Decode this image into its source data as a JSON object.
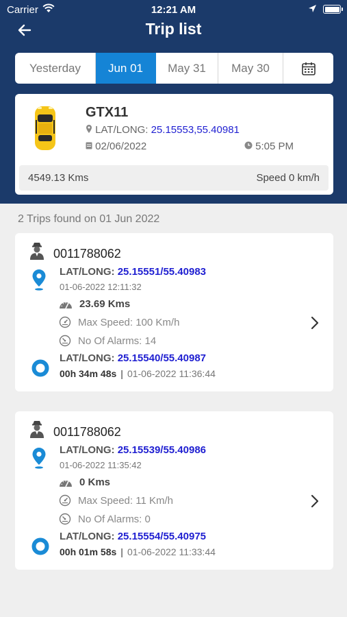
{
  "status_bar": {
    "carrier": "Carrier",
    "time": "12:21 AM"
  },
  "header": {
    "title": "Trip list"
  },
  "date_tabs": [
    {
      "label": "Yesterday",
      "active": false
    },
    {
      "label": "Jun 01",
      "active": true
    },
    {
      "label": "May 31",
      "active": false
    },
    {
      "label": "May 30",
      "active": false
    },
    {
      "icon": "calendar-icon"
    }
  ],
  "vehicle": {
    "name": "GTX11",
    "latlong_label": "LAT/LONG:",
    "latlong_value": "25.15553,55.40981",
    "date": "02/06/2022",
    "time": "5:05 PM",
    "kms": "4549.13 Kms",
    "speed": "Speed 0 km/h"
  },
  "summary": "2 Trips found on 01 Jun 2022",
  "trips": [
    {
      "driver_id": "0011788062",
      "start_latlong_label": "LAT/LONG:",
      "start_latlong_value": "25.15551/55.40983",
      "start_datetime": "01-06-2022 12:11:32",
      "distance": "23.69 Kms",
      "max_speed": "Max Speed: 100 Km/h",
      "alarms": "No Of Alarms: 14",
      "end_latlong_label": "LAT/LONG:",
      "end_latlong_value": "25.15540/55.40987",
      "duration": "00h 34m 48s",
      "separator": "|",
      "end_datetime": "01-06-2022 11:36:44"
    },
    {
      "driver_id": "0011788062",
      "start_latlong_label": "LAT/LONG:",
      "start_latlong_value": "25.15539/55.40986",
      "start_datetime": "01-06-2022 11:35:42",
      "distance": "0 Kms",
      "max_speed": "Max Speed: 11 Km/h",
      "alarms": "No Of Alarms: 0",
      "end_latlong_label": "LAT/LONG:",
      "end_latlong_value": "25.15554/55.40975",
      "duration": "00h 01m 58s",
      "separator": "|",
      "end_datetime": "01-06-2022 11:33:44"
    }
  ],
  "colors": {
    "header_bg": "#1b3a6a",
    "active_tab": "#1584d6",
    "coordinate_text": "#1f1fd1",
    "pin": "#1a8bd6",
    "car_body": "#f5c518"
  }
}
